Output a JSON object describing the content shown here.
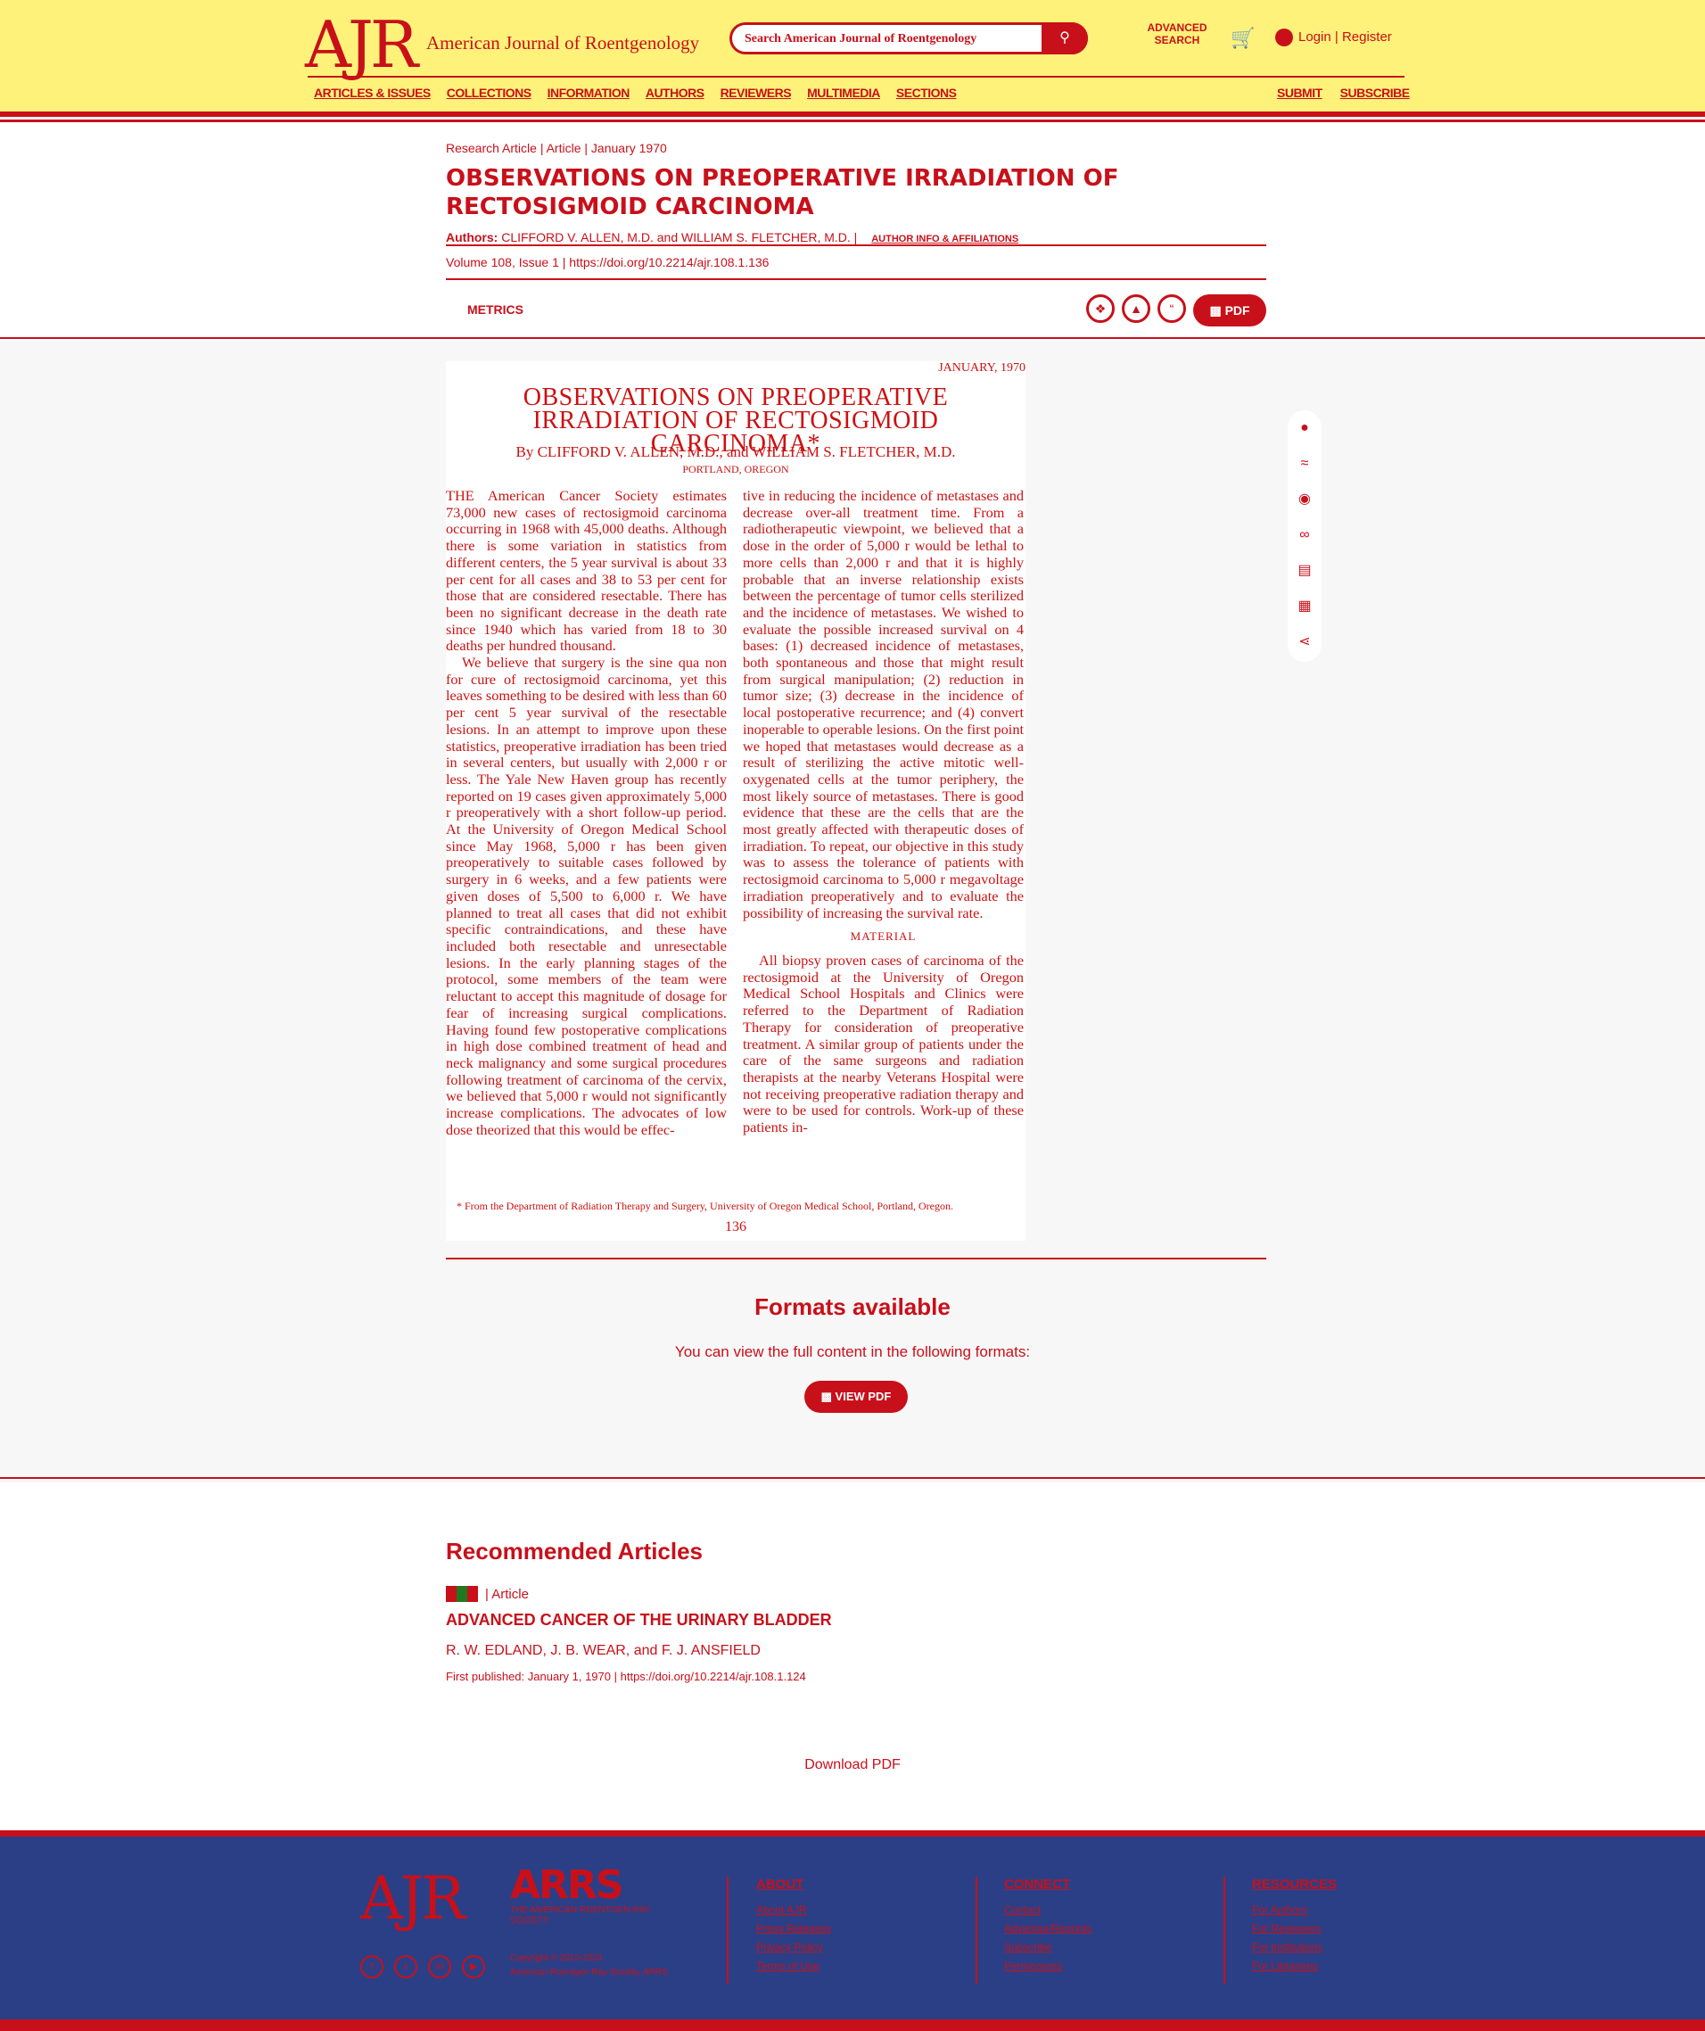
{
  "header": {
    "logo": "AJR",
    "journal_name": "American Journal of Roentgenology",
    "search_placeholder": "Search American Journal of Roentgenology",
    "advanced_search": "ADVANCED SEARCH",
    "login": "Login",
    "register": "Register",
    "nav": [
      "ARTICLES & ISSUES",
      "COLLECTIONS",
      "INFORMATION",
      "AUTHORS",
      "REVIEWERS",
      "MULTIMEDIA",
      "SECTIONS"
    ],
    "nav_right": [
      "SUBMIT",
      "SUBSCRIBE"
    ]
  },
  "article": {
    "crumb_type": "Research Article",
    "crumb_section": "Article",
    "crumb_date": "January 1970",
    "title": "OBSERVATIONS ON PREOPERATIVE IRRADIATION OF RECTOSIGMOID CARCINOMA",
    "authors_label": "Authors:",
    "authors": "CLIFFORD V. ALLEN, M.D. and WILLIAM S. FLETCHER, M.D.",
    "affiliations_link": "AUTHOR INFO & AFFILIATIONS",
    "volume": "Volume 108, Issue 1",
    "doi": "https://doi.org/10.2214/ajr.108.1.136",
    "metrics": "METRICS",
    "pdf": "PDF"
  },
  "scan": {
    "date": "JANUARY, 1970",
    "title": "OBSERVATIONS ON PREOPERATIVE IRRADIATION OF RECTOSIGMOID CARCINOMA*",
    "byline": "By CLIFFORD V. ALLEN, M.D., and WILLIAM S. FLETCHER, M.D.",
    "location": "PORTLAND, OREGON",
    "col1_p1": "THE American Cancer Society estimates 73,000 new cases of rectosigmoid carcinoma occurring in 1968 with 45,000 deaths. Although there is some variation in statistics from different centers, the 5 year survival is about 33 per cent for all cases and 38 to 53 per cent for those that are considered resectable. There has been no significant decrease in the death rate since 1940 which has varied from 18 to 30 deaths per hundred thousand.",
    "col1_p2": "We believe that surgery is the sine qua non for cure of rectosigmoid carcinoma, yet this leaves something to be desired with less than 60 per cent 5 year survival of the resectable lesions. In an attempt to improve upon these statistics, preoperative irradiation has been tried in several centers, but usually with 2,000 r or less. The Yale New Haven group has recently reported on 19 cases given approximately 5,000 r preoperatively with a short follow-up period. At the University of Oregon Medical School since May 1968, 5,000 r has been given preoperatively to suitable cases followed by surgery in 6 weeks, and a few patients were given doses of 5,500 to 6,000 r. We have planned to treat all cases that did not exhibit specific contraindications, and these have included both resectable and unresectable lesions. In the early planning stages of the protocol, some members of the team were reluctant to accept this magnitude of dosage for fear of increasing surgical complications. Having found few postoperative complications in high dose combined treatment of head and neck malignancy and some surgical procedures following treatment of carcinoma of the cervix, we believed that 5,000 r would not significantly increase complications. The advocates of low dose theorized that this would be effec-",
    "col2_p1": "tive in reducing the incidence of metastases and decrease over-all treatment time. From a radiotherapeutic viewpoint, we believed that a dose in the order of 5,000 r would be lethal to more cells than 2,000 r and that it is highly probable that an inverse relationship exists between the percentage of tumor cells sterilized and the incidence of metastases. We wished to evaluate the possible increased survival on 4 bases: (1) decreased incidence of metastases, both spontaneous and those that might result from surgical manipulation; (2) reduction in tumor size; (3) decrease in the incidence of local postoperative recurrence; and (4) convert inoperable to operable lesions. On the first point we hoped that metastases would decrease as a result of sterilizing the active mitotic well-oxygenated cells at the tumor periphery, the most likely source of metastases. There is good evidence that these are the cells that are the most greatly affected with therapeutic doses of irradiation. To repeat, our objective in this study was to assess the tolerance of patients with rectosigmoid carcinoma to 5,000 r megavoltage irradiation preoperatively and to evaluate the possibility of increasing the survival rate.",
    "col2_heading": "MATERIAL",
    "col2_p2": "All biopsy proven cases of carcinoma of the rectosigmoid at the University of Oregon Medical School Hospitals and Clinics were referred to the Department of Radiation Therapy for consideration of preoperative treatment. A similar group of patients under the care of the same surgeons and radiation therapists at the nearby Veterans Hospital were not receiving preoperative radiation therapy and were to be used for controls. Work-up of these patients in-",
    "footnote": "* From the Department of Radiation Therapy and Surgery, University of Oregon Medical School, Portland, Oregon.",
    "page_number": "136"
  },
  "formats": {
    "title": "Formats available",
    "description": "You can view the full content in the following formats:",
    "view_pdf": "VIEW PDF"
  },
  "recommended": {
    "heading": "Recommended Articles",
    "type": "Article",
    "title": "ADVANCED CANCER OF THE URINARY BLADDER",
    "authors": "R. W. EDLAND, J. B. WEAR, and F. J. ANSFIELD",
    "published": "First published: January 1, 1970",
    "doi": "https://doi.org/10.2214/ajr.108.1.124",
    "download": "Download PDF"
  },
  "footer": {
    "logo": "AJR",
    "arrs": "ARRS",
    "arrs_sub": "THE AMERICAN ROENTGEN RAY SOCIETY",
    "copyright_1": "Copyright © 2012-2024",
    "copyright_2": "American Roentgen Ray Society, ARRS.",
    "about_heading": "ABOUT",
    "about": [
      "About AJR",
      "Press Releases",
      "Privacy Policy",
      "Terms of Use"
    ],
    "connect_heading": "CONNECT",
    "connect": [
      "Contact",
      "Advertise/Reprints",
      "Subscribe",
      "Permissions"
    ],
    "resources_heading": "RESOURCES",
    "resources": [
      "For Authors",
      "For Reviewers",
      "For Institutions",
      "For Librarians"
    ]
  }
}
